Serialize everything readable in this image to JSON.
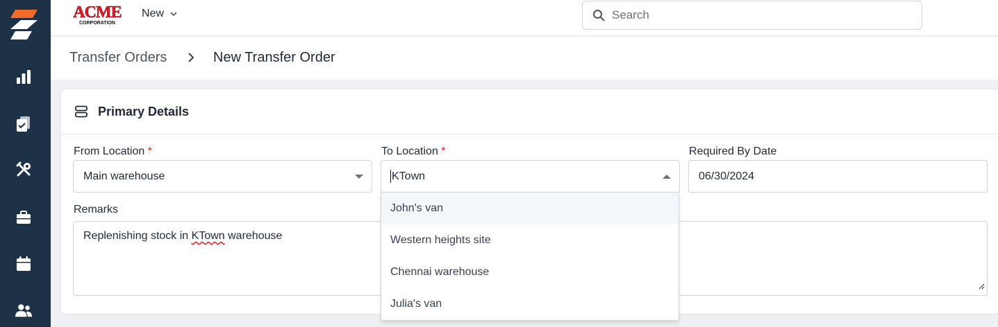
{
  "brand": {
    "logo_text": "ACME",
    "logo_subtext": "CORPORATION"
  },
  "topbar": {
    "new_label": "New",
    "search_placeholder": "Search"
  },
  "breadcrumb": {
    "parent": "Transfer Orders",
    "current": "New Transfer Order"
  },
  "sidebar": {
    "items": [
      {
        "icon": "bar-chart-icon"
      },
      {
        "icon": "clipboard-check-icon"
      },
      {
        "icon": "tools-icon"
      },
      {
        "icon": "briefcase-icon"
      },
      {
        "icon": "calendar-icon"
      },
      {
        "icon": "users-icon"
      }
    ]
  },
  "section": {
    "title": "Primary Details"
  },
  "form": {
    "from_location": {
      "label": "From Location",
      "value": "Main warehouse"
    },
    "to_location": {
      "label": "To Location",
      "value": "KTown",
      "options": [
        "John's van",
        "Western heights site",
        "Chennai warehouse",
        "Julia's van"
      ]
    },
    "required_by": {
      "label": "Required By Date",
      "value": "06/30/2024"
    },
    "remarks": {
      "label": "Remarks",
      "value_before": "Replenishing stock in ",
      "value_misspelled": "KTown",
      "value_after": " warehouse"
    },
    "required_marker": "*"
  },
  "colors": {
    "sidebar_bg": "#1e3247",
    "accent_orange": "#f26b2a",
    "required_red": "#dc2626"
  }
}
